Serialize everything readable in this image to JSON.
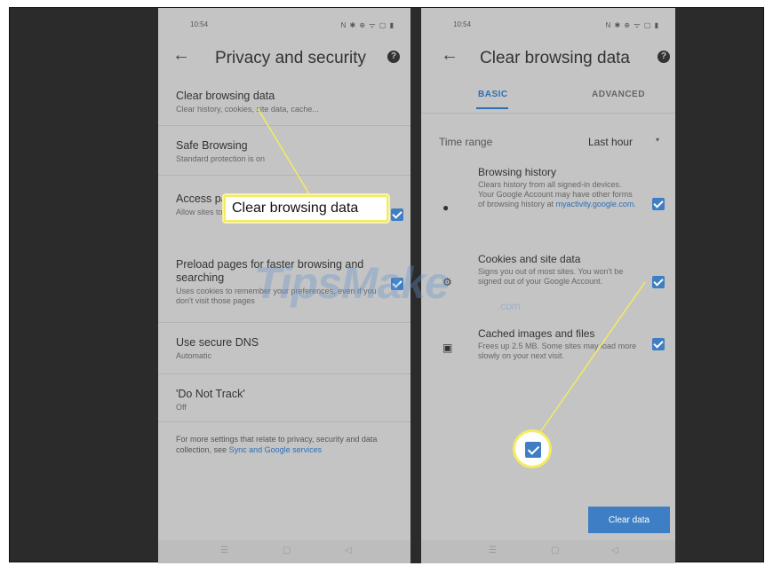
{
  "left": {
    "status_time": "10:54",
    "status_icons": "N ✱ ⊕ ᯤ ▢ ▮",
    "back": "←",
    "title": "Privacy and security",
    "help": "?",
    "settings": [
      {
        "title": "Clear browsing data",
        "subtitle": "Clear history, cookies, site data, cache..."
      },
      {
        "title": "Safe Browsing",
        "subtitle": "Standard protection is on"
      },
      {
        "title": "Access payment methods",
        "subtitle": "Allow sites to check if you have payment methods saved"
      },
      {
        "title": "Preload pages for faster browsing and searching",
        "subtitle": "Uses cookies to remember your preferences, even if you don't visit those pages"
      },
      {
        "title": "Use secure DNS",
        "subtitle": "Automatic"
      },
      {
        "title": "'Do Not Track'",
        "subtitle": "Off"
      }
    ],
    "footer": "For more settings that relate to privacy, security and data collection, see",
    "footer_link": "Sync and Google services",
    "nav": [
      "☰",
      "▢",
      "◁"
    ]
  },
  "right": {
    "status_time": "10:54",
    "status_icons": "N ✱ ⊕ ᯤ ▢ ▮",
    "back": "←",
    "title": "Clear browsing data",
    "help": "?",
    "tabs": {
      "basic": "BASIC",
      "advanced": "ADVANCED"
    },
    "time_range_label": "Time range",
    "time_range_value": "Last hour",
    "caret": "▾",
    "items": [
      {
        "icon": "●",
        "title": "Browsing history",
        "subtitle": "Clears history from all signed-in devices. Your Google Account may have other forms of browsing history at",
        "link": "myactivity.google.com."
      },
      {
        "icon": "⚙",
        "title": "Cookies and site data",
        "subtitle": "Signs you out of most sites. You won't be signed out of your Google Account."
      },
      {
        "icon": "▣",
        "title": "Cached images and files",
        "subtitle": "Frees up 2.5 MB. Some sites may load more slowly on your next visit."
      }
    ],
    "clear_button": "Clear data",
    "nav": [
      "☰",
      "▢",
      "◁"
    ]
  },
  "callout": "Clear browsing data",
  "watermark": "TipsMake",
  "watermark_suffix": ".com",
  "colors": {
    "accent": "#3d7ec4",
    "highlight": "#f2ec5e",
    "panel": "#c4c4c4",
    "frame": "#2b2b2b"
  }
}
